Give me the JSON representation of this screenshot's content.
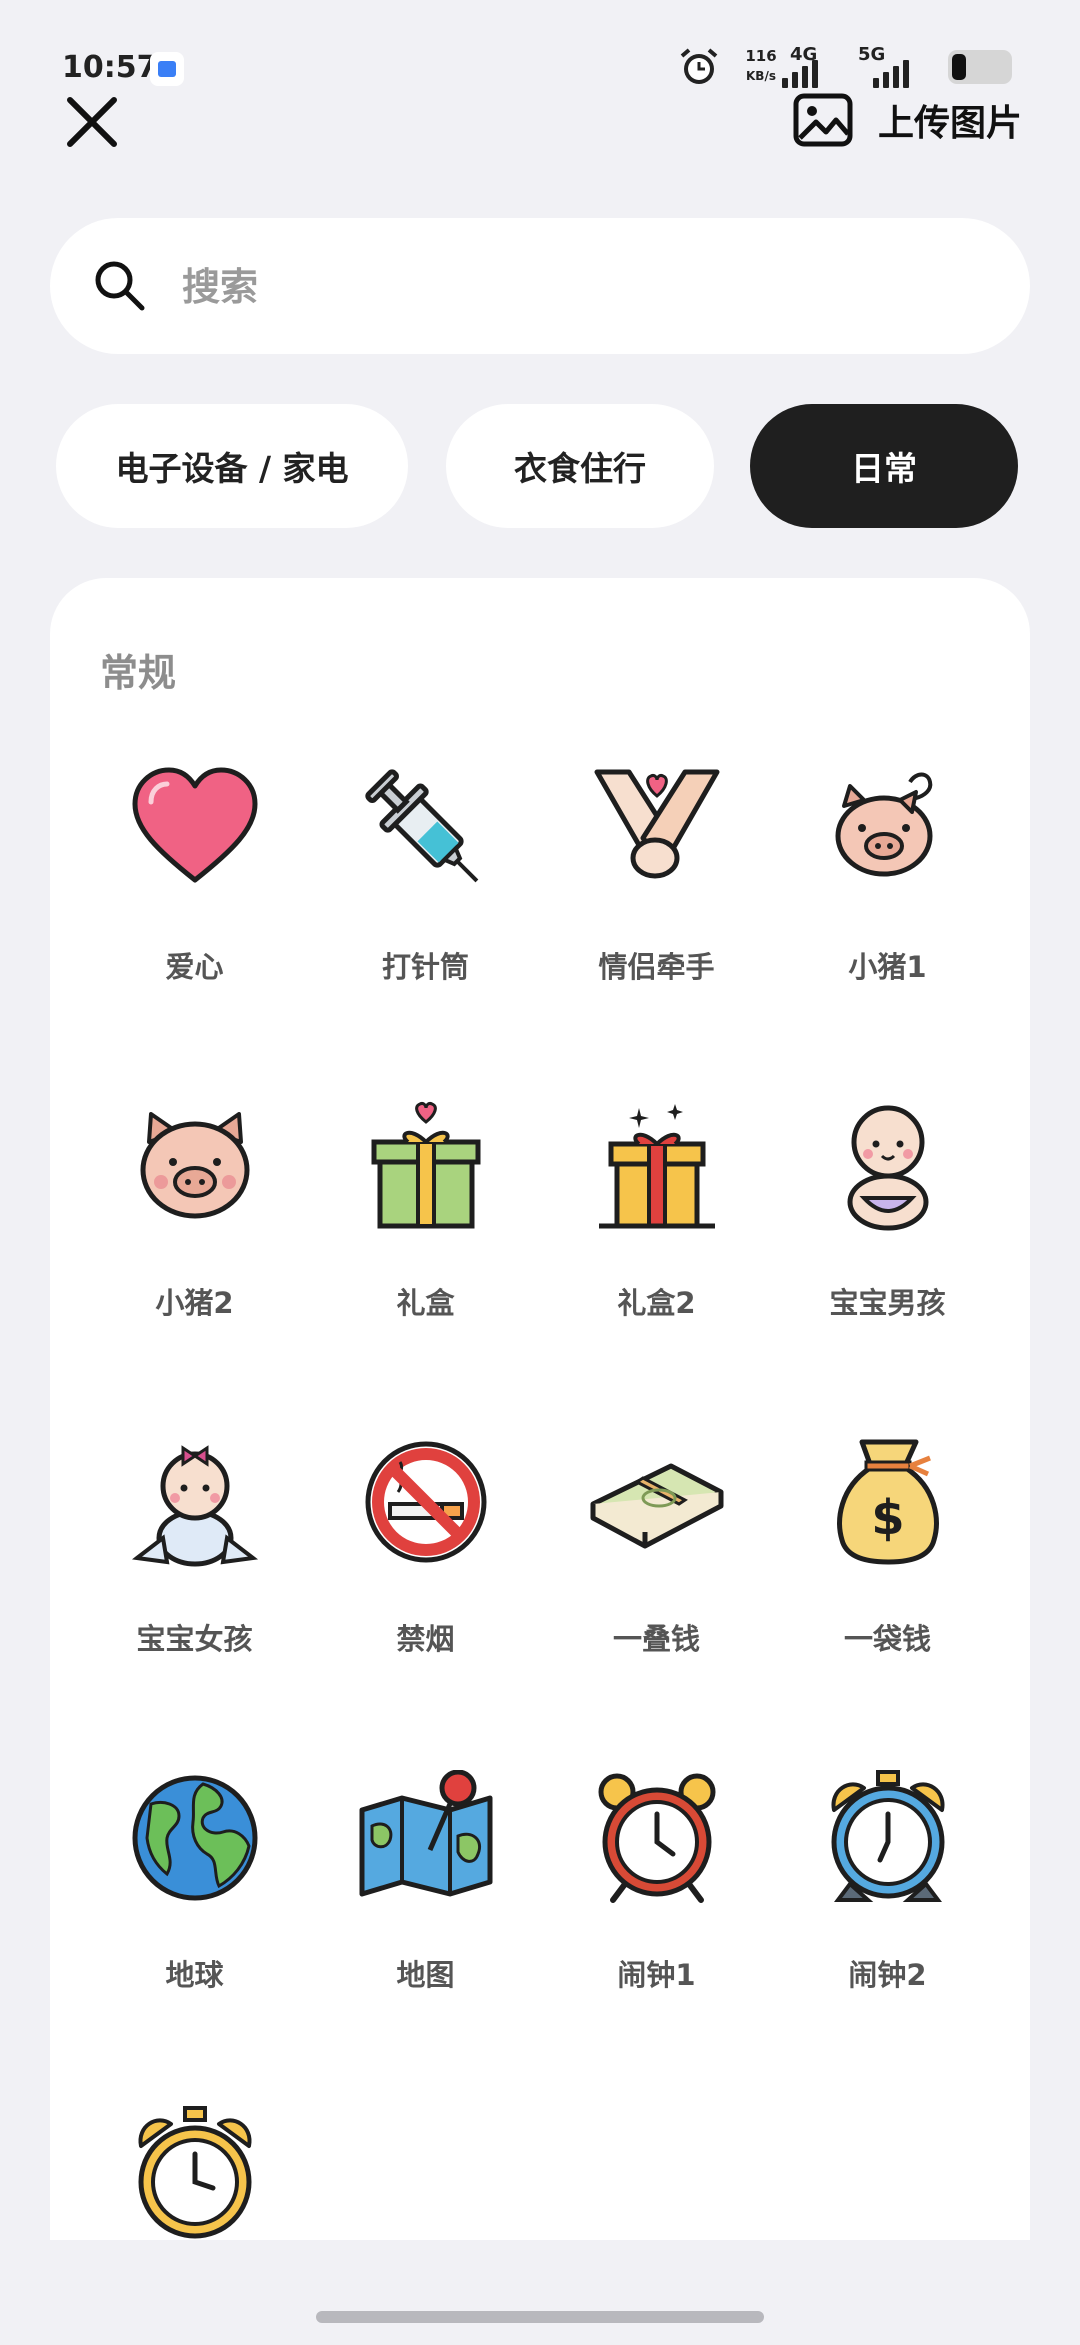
{
  "status_bar": {
    "time": "10:57",
    "speed_value": "116",
    "speed_unit": "KB/s",
    "net1": "4G",
    "net2": "5G"
  },
  "header": {
    "close_icon": "close-icon",
    "upload_label": "上传图片"
  },
  "search": {
    "placeholder": "搜索"
  },
  "tabs": [
    {
      "label": "电子设备 / 家电",
      "active": false
    },
    {
      "label": "衣食住行",
      "active": false
    },
    {
      "label": "日常",
      "active": true
    }
  ],
  "section": {
    "title": "常规",
    "items": [
      {
        "label": "爱心",
        "icon": "heart-icon"
      },
      {
        "label": "打针筒",
        "icon": "syringe-icon"
      },
      {
        "label": "情侣牵手",
        "icon": "holding-hands-icon"
      },
      {
        "label": "小猪1",
        "icon": "pig-icon"
      },
      {
        "label": "小猪2",
        "icon": "pig-face-icon"
      },
      {
        "label": "礼盒",
        "icon": "gift-box-icon"
      },
      {
        "label": "礼盒2",
        "icon": "gift-box-2-icon"
      },
      {
        "label": "宝宝男孩",
        "icon": "baby-boy-icon"
      },
      {
        "label": "宝宝女孩",
        "icon": "baby-girl-icon"
      },
      {
        "label": "禁烟",
        "icon": "no-smoking-icon"
      },
      {
        "label": "一叠钱",
        "icon": "cash-stack-icon"
      },
      {
        "label": "一袋钱",
        "icon": "money-bag-icon"
      },
      {
        "label": "地球",
        "icon": "globe-icon"
      },
      {
        "label": "地图",
        "icon": "map-icon"
      },
      {
        "label": "闹钟1",
        "icon": "alarm-clock-icon"
      },
      {
        "label": "闹钟2",
        "icon": "alarm-clock-2-icon"
      },
      {
        "label": "",
        "icon": "alarm-clock-3-icon"
      }
    ]
  }
}
